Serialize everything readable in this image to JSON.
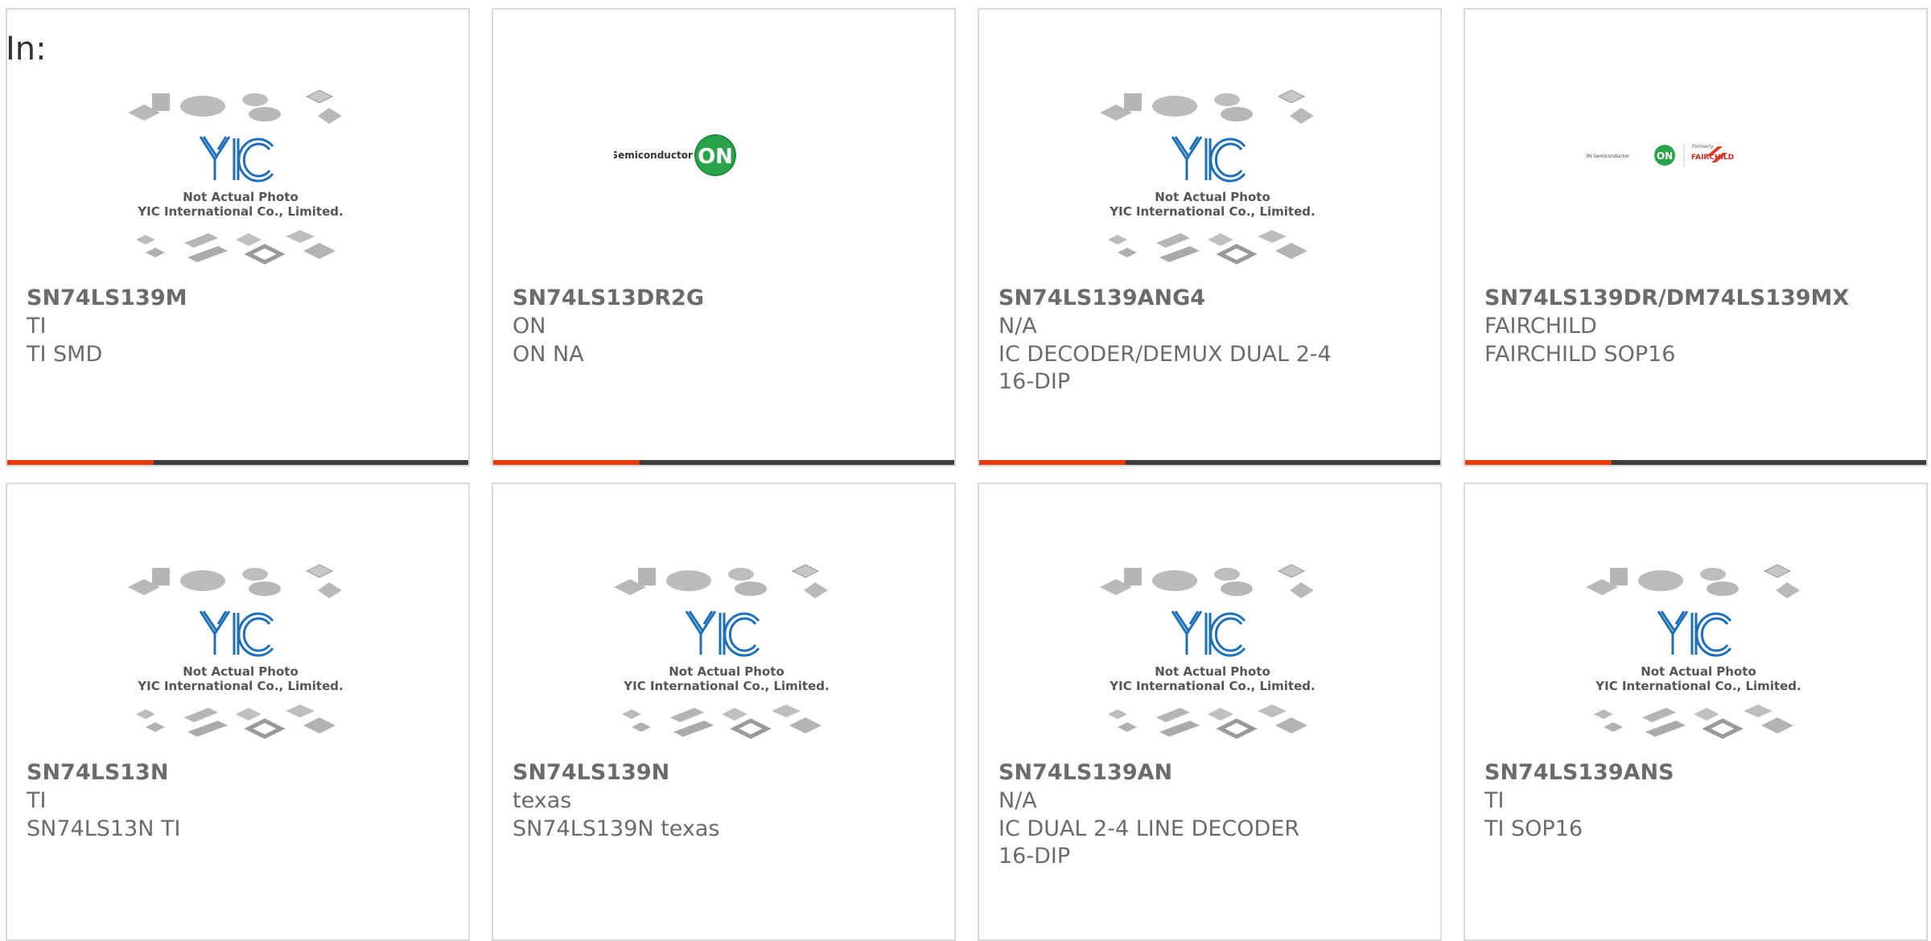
{
  "header": {
    "label": "In:"
  },
  "colors": {
    "accent": "#e8380d",
    "bar": "#3d3d3d",
    "border": "#d9d9d9",
    "text": "#6b6b6b",
    "yic_blue": "#1c6fb8"
  },
  "placeholder": {
    "line1": "Not Actual Photo",
    "line2": "YIC International Co., Limited."
  },
  "logos": {
    "on_text": "ON Semiconductor",
    "on_badge": "ON",
    "formerly": "Formerly",
    "fairchild": "FAIRCHILD"
  },
  "products": [
    {
      "name": "SN74LS139M",
      "manufacturer": "TI",
      "description": "TI SMD",
      "image": "yic-placeholder"
    },
    {
      "name": "SN74LS13DR2G",
      "manufacturer": "ON",
      "description": "ON NA",
      "image": "on-semiconductor-logo"
    },
    {
      "name": "SN74LS139ANG4",
      "manufacturer": "N/A",
      "description": "IC DECODER/DEMUX DUAL 2-4 16-DIP",
      "image": "yic-placeholder"
    },
    {
      "name": "SN74LS139DR/DM74LS139MX",
      "manufacturer": "FAIRCHILD",
      "description": "FAIRCHILD SOP16",
      "image": "on-fairchild-logo"
    },
    {
      "name": "SN74LS13N",
      "manufacturer": "TI",
      "description": "SN74LS13N TI",
      "image": "yic-placeholder"
    },
    {
      "name": "SN74LS139N",
      "manufacturer": "texas",
      "description": "SN74LS139N texas",
      "image": "yic-placeholder"
    },
    {
      "name": "SN74LS139AN",
      "manufacturer": "N/A",
      "description": "IC DUAL 2-4 LINE DECODER 16-DIP",
      "image": "yic-placeholder"
    },
    {
      "name": "SN74LS139ANS",
      "manufacturer": "TI",
      "description": "TI SOP16",
      "image": "yic-placeholder"
    }
  ]
}
